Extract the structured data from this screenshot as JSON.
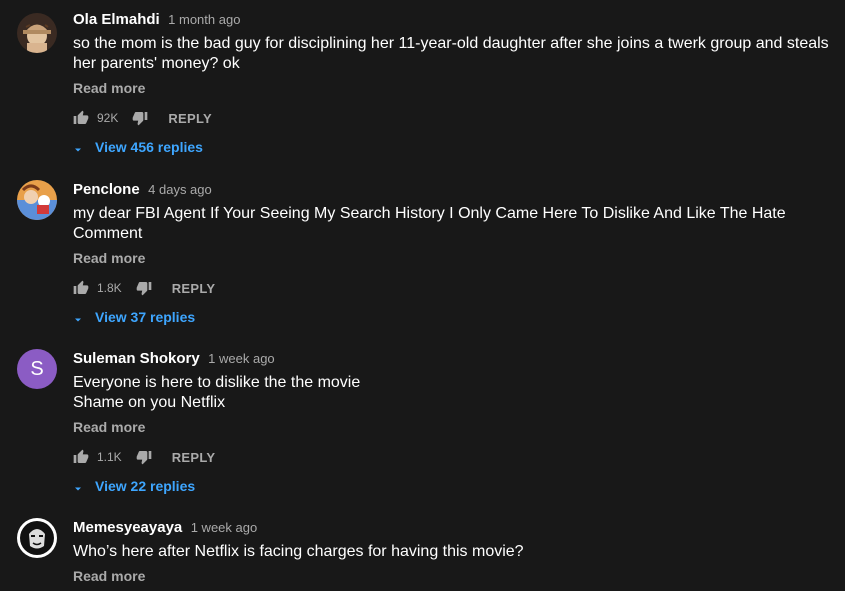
{
  "colors": {
    "background": "#181818",
    "link": "#3ea6ff",
    "muted": "#aaaaaa",
    "text": "#ffffff",
    "avatar_purple": "#8b5cc4"
  },
  "comments": [
    {
      "author": "Ola Elmahdi",
      "time": "1 month ago",
      "text": "so the mom is the bad guy for disciplining her 11-year-old daughter after she joins a twerk group and steals her parents' money? ok",
      "read_more": "Read more",
      "likes": "92K",
      "reply_label": "REPLY",
      "view_replies": "View 456 replies",
      "avatar": "photo-hat-woman"
    },
    {
      "author": "Penclone",
      "time": "4 days ago",
      "text": "my dear FBI Agent If Your Seeing My Search History I Only Came Here To Dislike And Like The Hate Comment",
      "read_more": "Read more",
      "likes": "1.8K",
      "reply_label": "REPLY",
      "view_replies": "View 37 replies",
      "avatar": "photo-cartoon"
    },
    {
      "author": "Suleman Shokory",
      "time": "1 week ago",
      "text_lines": [
        "Everyone is here to dislike the the movie",
        "Shame on you Netflix"
      ],
      "read_more": "Read more",
      "likes": "1.1K",
      "reply_label": "REPLY",
      "view_replies": "View 22 replies",
      "avatar_letter": "S"
    },
    {
      "author": "Memesyeayaya",
      "time": "1 week ago",
      "text": "Who’s here after Netflix is facing charges for having this movie?",
      "read_more": "Read more",
      "avatar": "photo-anonymous-mask"
    }
  ]
}
